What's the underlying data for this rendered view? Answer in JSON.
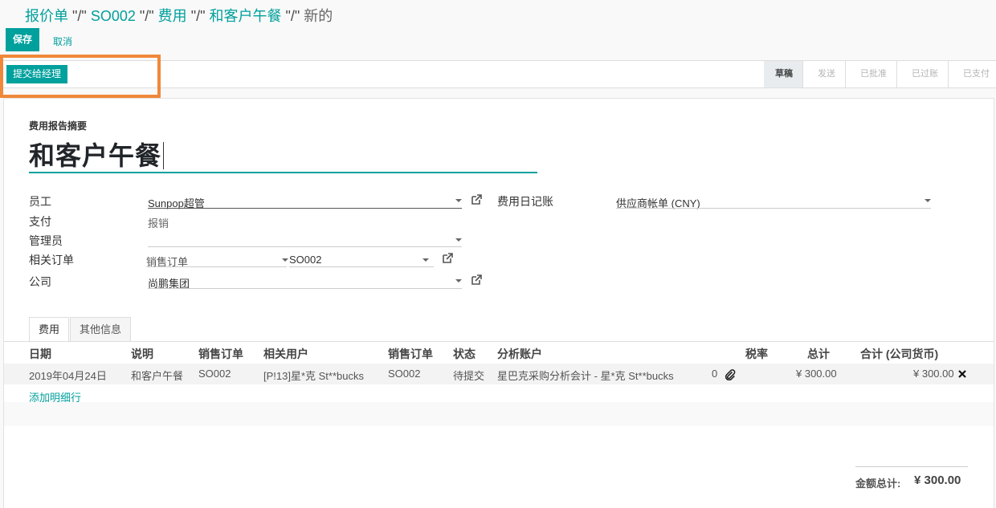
{
  "breadcrumb": {
    "items": [
      "报价单",
      "SO002",
      "费用",
      "和客户午餐"
    ],
    "separator": "\"/\"",
    "current": "新的"
  },
  "toolbar": {
    "save_label": "保存",
    "cancel_label": "取消"
  },
  "statusbar": {
    "submit_label": "提交给经理",
    "stages": [
      "草稿",
      "发送",
      "已批准",
      "已过账",
      "已支付"
    ],
    "active_stage": "草稿"
  },
  "form": {
    "summary_label": "费用报告摘要",
    "title": "和客户午餐",
    "employee_label": "员工",
    "employee_value": "Sunpop超管",
    "payment_label": "支付",
    "payment_value": "报销",
    "manager_label": "管理员",
    "manager_value": "",
    "order_label": "相关订单",
    "order_model": "销售订单",
    "order_value": "SO002",
    "company_label": "公司",
    "company_value": "尚鹏集团",
    "journal_label": "费用日记账",
    "journal_value": "供应商帐单 (CNY)"
  },
  "tabs": {
    "expense": "费用",
    "other": "其他信息"
  },
  "table": {
    "headers": {
      "date": "日期",
      "desc": "说明",
      "so": "销售订单",
      "user": "相关用户",
      "so2": "销售订单",
      "state": "状态",
      "analytic": "分析账户",
      "tax": "税率",
      "total": "总计",
      "total_company": "合计 (公司货币)"
    },
    "rows": [
      {
        "date": "2019年04月24日",
        "desc": "和客户午餐",
        "so": "SO002",
        "user": "[P!13]星*克 St**bucks",
        "so2": "SO002",
        "state": "待提交",
        "analytic": "星巴克采购分析会计 - 星*克 St**bucks",
        "attachments": "0",
        "total": "¥ 300.00",
        "total_company": "¥ 300.00"
      }
    ],
    "add_line": "添加明细行"
  },
  "totals": {
    "label": "金额总计:",
    "value": "¥ 300.00"
  },
  "colors": {
    "accent": "#00a09d",
    "highlight": "#f0883a"
  }
}
